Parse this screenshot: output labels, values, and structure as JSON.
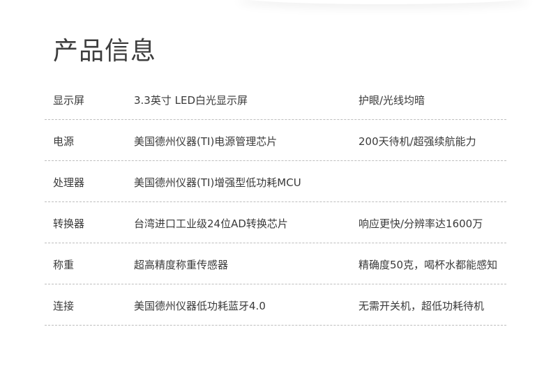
{
  "title": "产品信息",
  "rows": [
    {
      "name": "显示屏",
      "detail": "3.3英寸 LED白光显示屏",
      "benefit": "护眼/光线均暗"
    },
    {
      "name": "电源",
      "detail": "美国德州仪器(TI)电源管理芯片",
      "benefit": "200天待机/超强续航能力"
    },
    {
      "name": "处理器",
      "detail": "美国德州仪器(TI)增强型低功耗MCU",
      "benefit": ""
    },
    {
      "name": "转换器",
      "detail": "台湾进口工业级24位AD转换芯片",
      "benefit": "响应更快/分辨率达1600万"
    },
    {
      "name": "称重",
      "detail": "超高精度称重传感器",
      "benefit": "精确度50克，喝杯水都能感知"
    },
    {
      "name": "连接",
      "detail": "美国德州仪器低功耗蓝牙4.0",
      "benefit": "无需开关机，超低功耗待机"
    }
  ]
}
